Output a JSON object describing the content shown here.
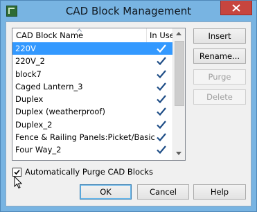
{
  "window": {
    "title": "CAD Block Management",
    "icon": "chief-architect-app-icon",
    "close_icon": "close-icon"
  },
  "list": {
    "columns": [
      "CAD Block Name",
      "In Use"
    ],
    "sort_icon": "sort-ascending-icon",
    "items": [
      {
        "name": "220V",
        "in_use": true,
        "selected": true
      },
      {
        "name": "220V_2",
        "in_use": true,
        "selected": false
      },
      {
        "name": "block7",
        "in_use": true,
        "selected": false
      },
      {
        "name": "Caged Lantern_3",
        "in_use": true,
        "selected": false
      },
      {
        "name": "Duplex",
        "in_use": true,
        "selected": false
      },
      {
        "name": "Duplex (weatherproof)",
        "in_use": true,
        "selected": false
      },
      {
        "name": "Duplex_2",
        "in_use": true,
        "selected": false
      },
      {
        "name": "Fence & Railing Panels:Picket/Basic",
        "in_use": true,
        "selected": false
      },
      {
        "name": "Four Way_2",
        "in_use": true,
        "selected": false
      }
    ],
    "colors": {
      "selected_bg": "#3399ff",
      "check": "#1f4e87"
    }
  },
  "buttons": {
    "insert": "Insert",
    "rename": "Rename...",
    "purge": "Purge",
    "delete": "Delete",
    "ok": "OK",
    "cancel": "Cancel",
    "help": "Help"
  },
  "auto_purge": {
    "label": "Automatically Purge CAD Blocks",
    "checked": true
  }
}
